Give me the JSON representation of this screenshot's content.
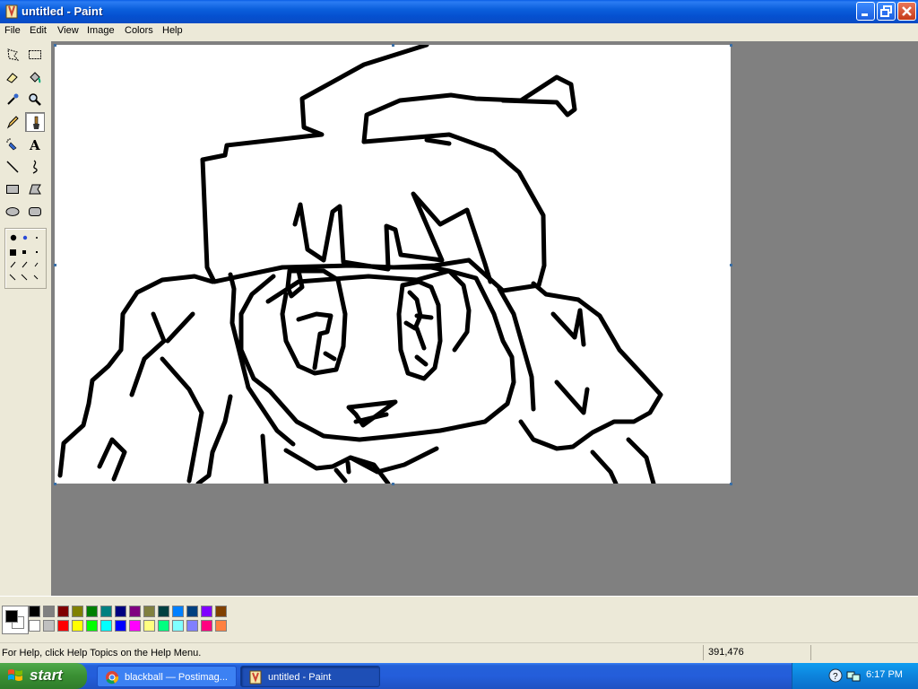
{
  "window": {
    "title": "untitled - Paint"
  },
  "menu": [
    "File",
    "Edit",
    "View",
    "Image",
    "Colors",
    "Help"
  ],
  "tools": [
    "free-form-select",
    "select",
    "eraser",
    "fill-with-color",
    "pick-color",
    "magnifier",
    "pencil",
    "brush",
    "airbrush",
    "text",
    "line",
    "curve",
    "rectangle",
    "polygon",
    "ellipse",
    "rounded-rectangle"
  ],
  "palette": {
    "top": [
      "#000000",
      "#808080",
      "#800000",
      "#808000",
      "#008000",
      "#008080",
      "#000080",
      "#800080",
      "#808040",
      "#004040",
      "#0080ff",
      "#004080",
      "#8000ff",
      "#804000"
    ],
    "bottom": [
      "#ffffff",
      "#c0c0c0",
      "#ff0000",
      "#ffff00",
      "#00ff00",
      "#00ffff",
      "#0000ff",
      "#ff00ff",
      "#ffff80",
      "#00ff80",
      "#80ffff",
      "#8080ff",
      "#ff0080",
      "#ff8040"
    ],
    "foreground": "#000000",
    "background": "#ffffff"
  },
  "status": {
    "help": "For Help, click Help Topics on the Help Menu.",
    "coords": "391,476"
  },
  "taskbar": {
    "start": "start",
    "tasks": [
      {
        "label": "blackball — Postimag...",
        "icon": "chrome-icon"
      },
      {
        "label": "untitled - Paint",
        "icon": "paint-icon"
      }
    ],
    "clock": "6:17 PM"
  }
}
